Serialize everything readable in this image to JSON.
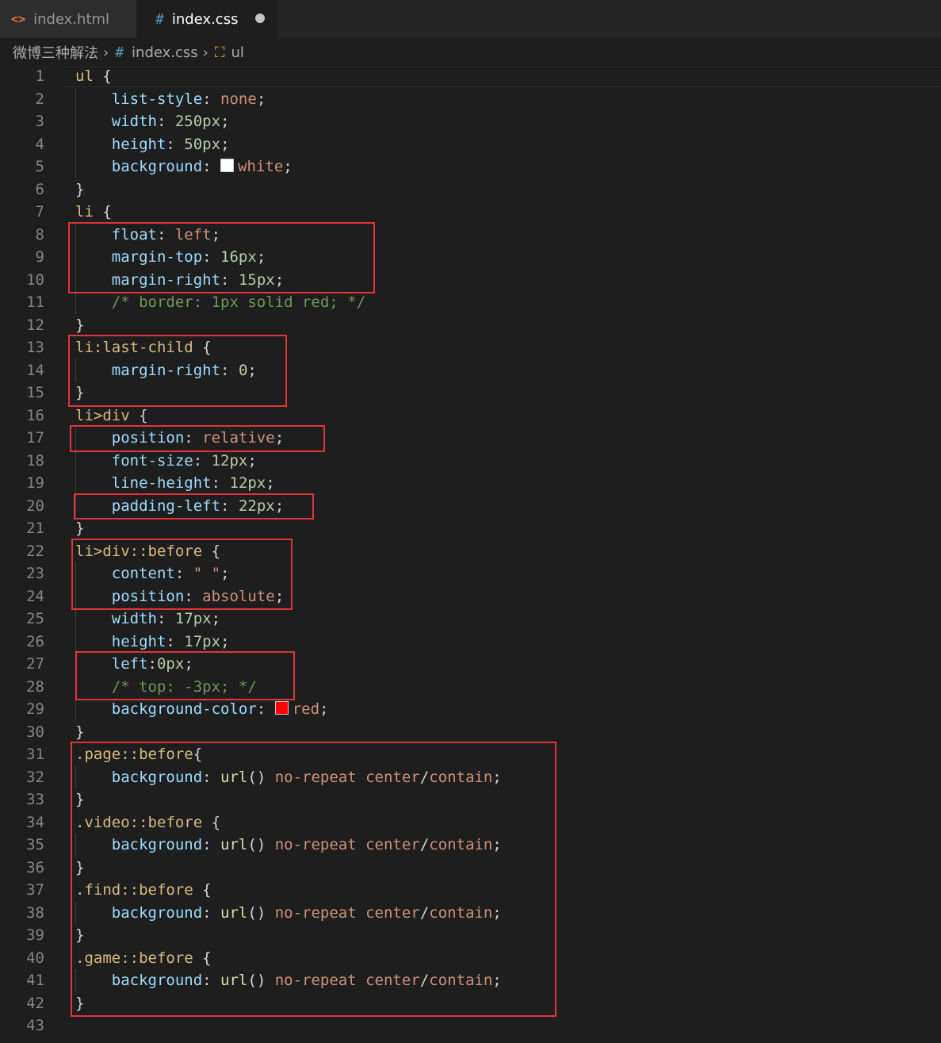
{
  "tabs": [
    {
      "icon": "<>",
      "label": "index.html",
      "active": false
    },
    {
      "icon": "#",
      "label": "index.css",
      "active": true,
      "modified": true
    }
  ],
  "breadcrumb": {
    "folder": "微博三种解法",
    "file": "index.css",
    "symbol": "ul"
  },
  "colors": {
    "selector": "#d7ba7d",
    "property": "#9cdcfe",
    "value": "#ce9178",
    "number": "#b5cea8",
    "comment": "#6a9955",
    "highlight": "#e0343a"
  },
  "lines": [
    {
      "n": 1,
      "t": [
        [
          "sel",
          "ul"
        ],
        [
          "pun",
          " {"
        ]
      ]
    },
    {
      "n": 2,
      "t": [
        [
          "pun",
          "    "
        ],
        [
          "prop",
          "list-style"
        ],
        [
          "pun",
          ": "
        ],
        [
          "val",
          "none"
        ],
        [
          "pun",
          ";"
        ]
      ]
    },
    {
      "n": 3,
      "t": [
        [
          "pun",
          "    "
        ],
        [
          "prop",
          "width"
        ],
        [
          "pun",
          ": "
        ],
        [
          "num",
          "250px"
        ],
        [
          "pun",
          ";"
        ]
      ]
    },
    {
      "n": 4,
      "t": [
        [
          "pun",
          "    "
        ],
        [
          "prop",
          "height"
        ],
        [
          "pun",
          ": "
        ],
        [
          "num",
          "50px"
        ],
        [
          "pun",
          ";"
        ]
      ]
    },
    {
      "n": 5,
      "t": [
        [
          "pun",
          "    "
        ],
        [
          "prop",
          "background"
        ],
        [
          "pun",
          ": "
        ],
        [
          "swatch",
          "#ffffff"
        ],
        [
          "val",
          "white"
        ],
        [
          "pun",
          ";"
        ]
      ]
    },
    {
      "n": 6,
      "t": [
        [
          "pun",
          "}"
        ]
      ]
    },
    {
      "n": 7,
      "t": [
        [
          "sel",
          "li"
        ],
        [
          "pun",
          " {"
        ]
      ]
    },
    {
      "n": 8,
      "t": [
        [
          "pun",
          "    "
        ],
        [
          "prop",
          "float"
        ],
        [
          "pun",
          ": "
        ],
        [
          "val",
          "left"
        ],
        [
          "pun",
          ";"
        ]
      ]
    },
    {
      "n": 9,
      "t": [
        [
          "pun",
          "    "
        ],
        [
          "prop",
          "margin-top"
        ],
        [
          "pun",
          ": "
        ],
        [
          "num",
          "16px"
        ],
        [
          "pun",
          ";"
        ]
      ]
    },
    {
      "n": 10,
      "t": [
        [
          "pun",
          "    "
        ],
        [
          "prop",
          "margin-right"
        ],
        [
          "pun",
          ": "
        ],
        [
          "num",
          "15px"
        ],
        [
          "pun",
          ";"
        ]
      ]
    },
    {
      "n": 11,
      "t": [
        [
          "pun",
          "    "
        ],
        [
          "com",
          "/* border: 1px solid red; */"
        ]
      ]
    },
    {
      "n": 12,
      "t": [
        [
          "pun",
          "}"
        ]
      ]
    },
    {
      "n": 13,
      "t": [
        [
          "sel",
          "li:last-child"
        ],
        [
          "pun",
          " {"
        ]
      ]
    },
    {
      "n": 14,
      "t": [
        [
          "pun",
          "    "
        ],
        [
          "prop",
          "margin-right"
        ],
        [
          "pun",
          ": "
        ],
        [
          "num",
          "0"
        ],
        [
          "pun",
          ";"
        ]
      ]
    },
    {
      "n": 15,
      "t": [
        [
          "pun",
          "}"
        ]
      ]
    },
    {
      "n": 16,
      "t": [
        [
          "sel",
          "li>div"
        ],
        [
          "pun",
          " {"
        ]
      ]
    },
    {
      "n": 17,
      "t": [
        [
          "pun",
          "    "
        ],
        [
          "prop",
          "position"
        ],
        [
          "pun",
          ": "
        ],
        [
          "val",
          "relative"
        ],
        [
          "pun",
          ";"
        ]
      ]
    },
    {
      "n": 18,
      "t": [
        [
          "pun",
          "    "
        ],
        [
          "prop",
          "font-size"
        ],
        [
          "pun",
          ": "
        ],
        [
          "num",
          "12px"
        ],
        [
          "pun",
          ";"
        ]
      ]
    },
    {
      "n": 19,
      "t": [
        [
          "pun",
          "    "
        ],
        [
          "prop",
          "line-height"
        ],
        [
          "pun",
          ": "
        ],
        [
          "num",
          "12px"
        ],
        [
          "pun",
          ";"
        ]
      ]
    },
    {
      "n": 20,
      "t": [
        [
          "pun",
          "    "
        ],
        [
          "prop",
          "padding-left"
        ],
        [
          "pun",
          ": "
        ],
        [
          "num",
          "22px"
        ],
        [
          "pun",
          ";"
        ]
      ]
    },
    {
      "n": 21,
      "t": [
        [
          "pun",
          "}"
        ]
      ]
    },
    {
      "n": 22,
      "t": [
        [
          "sel",
          "li>div::before"
        ],
        [
          "pun",
          " {"
        ]
      ]
    },
    {
      "n": 23,
      "t": [
        [
          "pun",
          "    "
        ],
        [
          "prop",
          "content"
        ],
        [
          "pun",
          ": "
        ],
        [
          "val",
          "\" \""
        ],
        [
          "pun",
          ";"
        ]
      ]
    },
    {
      "n": 24,
      "t": [
        [
          "pun",
          "    "
        ],
        [
          "prop",
          "position"
        ],
        [
          "pun",
          ": "
        ],
        [
          "val",
          "absolute"
        ],
        [
          "pun",
          ";"
        ]
      ]
    },
    {
      "n": 25,
      "t": [
        [
          "pun",
          "    "
        ],
        [
          "prop",
          "width"
        ],
        [
          "pun",
          ": "
        ],
        [
          "num",
          "17px"
        ],
        [
          "pun",
          ";"
        ]
      ]
    },
    {
      "n": 26,
      "t": [
        [
          "pun",
          "    "
        ],
        [
          "prop",
          "height"
        ],
        [
          "pun",
          ": "
        ],
        [
          "num",
          "17px"
        ],
        [
          "pun",
          ";"
        ]
      ]
    },
    {
      "n": 27,
      "t": [
        [
          "pun",
          "    "
        ],
        [
          "prop",
          "left"
        ],
        [
          "pun",
          ":"
        ],
        [
          "num",
          "0px"
        ],
        [
          "pun",
          ";"
        ]
      ]
    },
    {
      "n": 28,
      "t": [
        [
          "pun",
          "    "
        ],
        [
          "com",
          "/* top: -3px; */"
        ]
      ]
    },
    {
      "n": 29,
      "t": [
        [
          "pun",
          "    "
        ],
        [
          "prop",
          "background-color"
        ],
        [
          "pun",
          ": "
        ],
        [
          "swatch",
          "#ff0000"
        ],
        [
          "val",
          "red"
        ],
        [
          "pun",
          ";"
        ]
      ]
    },
    {
      "n": 30,
      "t": [
        [
          "pun",
          "}"
        ]
      ]
    },
    {
      "n": 31,
      "t": [
        [
          "sel",
          ".page::before"
        ],
        [
          "pun",
          "{"
        ]
      ]
    },
    {
      "n": 32,
      "t": [
        [
          "pun",
          "    "
        ],
        [
          "prop",
          "background"
        ],
        [
          "pun",
          ": "
        ],
        [
          "fn",
          "url"
        ],
        [
          "pun",
          "() "
        ],
        [
          "val",
          "no-repeat"
        ],
        [
          "pun",
          " "
        ],
        [
          "val",
          "center"
        ],
        [
          "pun",
          "/"
        ],
        [
          "val",
          "contain"
        ],
        [
          "pun",
          ";"
        ]
      ]
    },
    {
      "n": 33,
      "t": [
        [
          "pun",
          "}"
        ]
      ]
    },
    {
      "n": 34,
      "t": [
        [
          "sel",
          ".video::before"
        ],
        [
          "pun",
          " {"
        ]
      ]
    },
    {
      "n": 35,
      "t": [
        [
          "pun",
          "    "
        ],
        [
          "prop",
          "background"
        ],
        [
          "pun",
          ": "
        ],
        [
          "fn",
          "url"
        ],
        [
          "pun",
          "() "
        ],
        [
          "val",
          "no-repeat"
        ],
        [
          "pun",
          " "
        ],
        [
          "val",
          "center"
        ],
        [
          "pun",
          "/"
        ],
        [
          "val",
          "contain"
        ],
        [
          "pun",
          ";"
        ]
      ]
    },
    {
      "n": 36,
      "t": [
        [
          "pun",
          "}"
        ]
      ]
    },
    {
      "n": 37,
      "t": [
        [
          "sel",
          ".find::before"
        ],
        [
          "pun",
          " {"
        ]
      ]
    },
    {
      "n": 38,
      "t": [
        [
          "pun",
          "    "
        ],
        [
          "prop",
          "background"
        ],
        [
          "pun",
          ": "
        ],
        [
          "fn",
          "url"
        ],
        [
          "pun",
          "() "
        ],
        [
          "val",
          "no-repeat"
        ],
        [
          "pun",
          " "
        ],
        [
          "val",
          "center"
        ],
        [
          "pun",
          "/"
        ],
        [
          "val",
          "contain"
        ],
        [
          "pun",
          ";"
        ]
      ]
    },
    {
      "n": 39,
      "t": [
        [
          "pun",
          "}"
        ]
      ]
    },
    {
      "n": 40,
      "t": [
        [
          "sel",
          ".game::before"
        ],
        [
          "pun",
          " {"
        ]
      ]
    },
    {
      "n": 41,
      "t": [
        [
          "pun",
          "    "
        ],
        [
          "prop",
          "background"
        ],
        [
          "pun",
          ": "
        ],
        [
          "fn",
          "url"
        ],
        [
          "pun",
          "() "
        ],
        [
          "val",
          "no-repeat"
        ],
        [
          "pun",
          " "
        ],
        [
          "val",
          "center"
        ],
        [
          "pun",
          "/"
        ],
        [
          "val",
          "contain"
        ],
        [
          "pun",
          ";"
        ]
      ]
    },
    {
      "n": 42,
      "t": [
        [
          "pun",
          "}"
        ]
      ]
    },
    {
      "n": 43,
      "t": []
    }
  ]
}
